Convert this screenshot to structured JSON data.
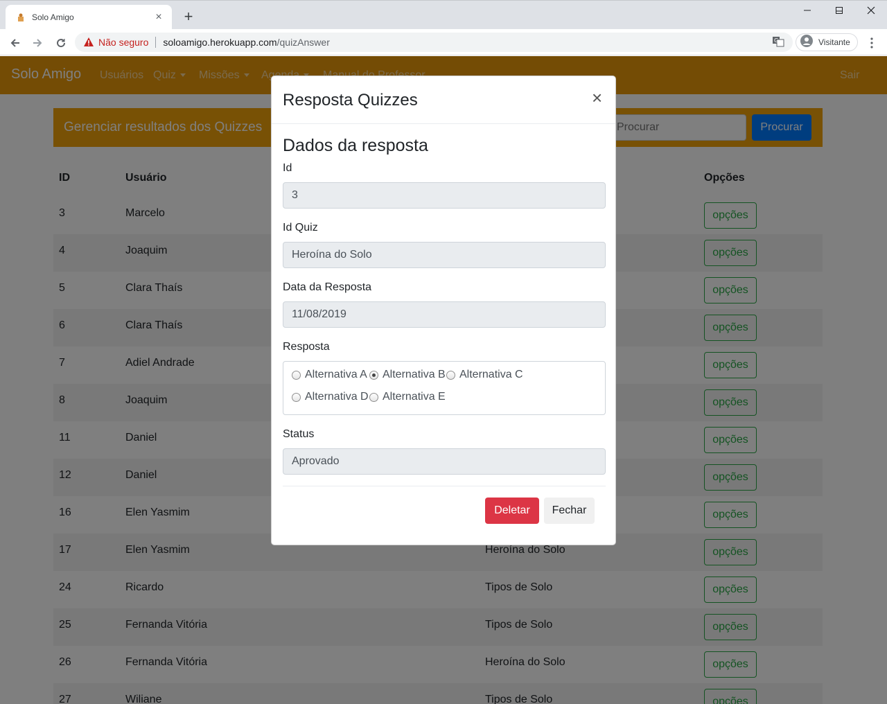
{
  "browser": {
    "tab_title": "Solo Amigo",
    "insecure_label": "Não seguro",
    "url_host": "soloamigo.herokuapp.com",
    "url_path": "/quizAnswer",
    "profile_label": "Visitante",
    "icons": [
      "favicon-icon",
      "close-icon",
      "plus-icon",
      "minimize-icon",
      "maximize-icon",
      "back-icon",
      "forward-icon",
      "reload-icon",
      "warning-icon",
      "translate-icon",
      "avatar-icon",
      "kebab-menu-icon"
    ]
  },
  "navbar": {
    "brand": "Solo Amigo",
    "items": [
      {
        "label": "Usuários",
        "dropdown": false
      },
      {
        "label": "Quiz",
        "dropdown": true
      },
      {
        "label": "Missões",
        "dropdown": true
      },
      {
        "label": "Agenda",
        "dropdown": true
      },
      {
        "label": "Manual do Professor",
        "dropdown": false
      }
    ],
    "logout": "Sair",
    "color": "#e8990b"
  },
  "header": {
    "title": "Gerenciar resultados dos Quizzes",
    "search_placeholder": "Procurar",
    "search_button": "Procurar",
    "color": "#f0a30a"
  },
  "table": {
    "columns": [
      "ID",
      "Usuário",
      "Opções"
    ],
    "option_label": "opções",
    "rows": [
      {
        "id": "3",
        "user": "Marcelo",
        "quiz": ""
      },
      {
        "id": "4",
        "user": "Joaquim",
        "quiz": ""
      },
      {
        "id": "5",
        "user": "Clara Thaís",
        "quiz": ""
      },
      {
        "id": "6",
        "user": "Clara Thaís",
        "quiz": ""
      },
      {
        "id": "7",
        "user": "Adiel Andrade",
        "quiz": ""
      },
      {
        "id": "8",
        "user": "Joaquim",
        "quiz": ""
      },
      {
        "id": "11",
        "user": "Daniel",
        "quiz": ""
      },
      {
        "id": "12",
        "user": "Daniel",
        "quiz": ""
      },
      {
        "id": "16",
        "user": "Elen Yasmim",
        "quiz": ""
      },
      {
        "id": "17",
        "user": "Elen Yasmim",
        "quiz": "Heroína do Solo"
      },
      {
        "id": "24",
        "user": "Ricardo",
        "quiz": "Tipos de Solo"
      },
      {
        "id": "25",
        "user": "Fernanda Vitória",
        "quiz": "Tipos de Solo"
      },
      {
        "id": "26",
        "user": "Fernanda Vitória",
        "quiz": "Heroína do Solo"
      },
      {
        "id": "27",
        "user": "Wiliane",
        "quiz": "Tipos de Solo"
      }
    ]
  },
  "modal": {
    "title": "Resposta Quizzes",
    "close_symbol": "×",
    "section_title": "Dados da resposta",
    "fields": {
      "id_label": "Id",
      "id_value": "3",
      "quiz_label": "Id Quiz",
      "quiz_value": "Heroína do Solo",
      "date_label": "Data da Resposta",
      "date_value": "11/08/2019",
      "answer_label": "Resposta",
      "status_label": "Status",
      "status_value": "Aprovado"
    },
    "options": [
      {
        "label": "Alternativa A",
        "checked": false
      },
      {
        "label": "Alternativa B",
        "checked": true
      },
      {
        "label": "Alternativa C",
        "checked": false
      },
      {
        "label": "Alternativa D",
        "checked": false
      },
      {
        "label": "Alternativa E",
        "checked": false
      }
    ],
    "delete_button": "Deletar",
    "close_button": "Fechar",
    "delete_color": "#dc3545"
  }
}
